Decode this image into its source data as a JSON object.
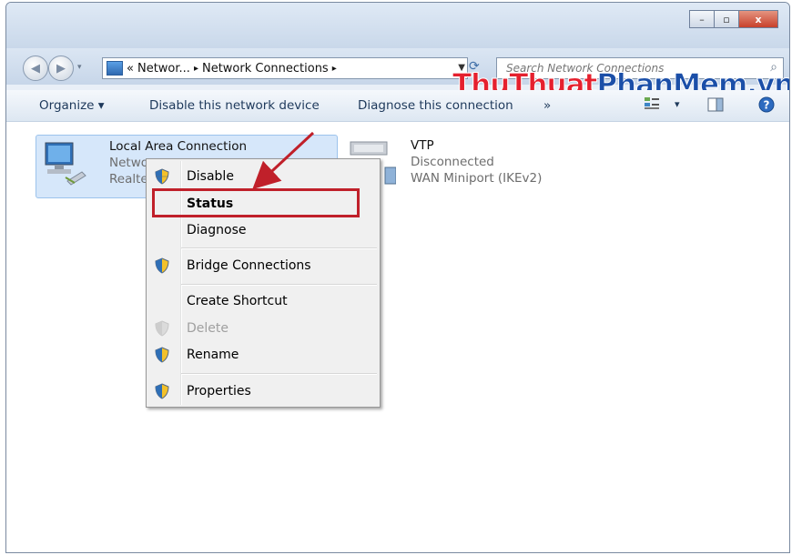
{
  "window": {
    "controls": {
      "minimize": "–",
      "maximize": "▫",
      "close": "x"
    }
  },
  "address": {
    "overflow": "«",
    "crumbs": [
      "Networ...",
      "Network Connections"
    ],
    "separator": "▸"
  },
  "search": {
    "placeholder": "Search Network Connections"
  },
  "watermark": {
    "part1": "ThuThuat",
    "part2": "PhanMem",
    "part3": ".vn"
  },
  "toolbar": {
    "organize": "Organize ▾",
    "disable": "Disable this network device",
    "diagnose": "Diagnose this connection",
    "more": "»",
    "views": "▾"
  },
  "connections": [
    {
      "name": "Local Area Connection",
      "line2": "Netwo",
      "line3": "Realtek"
    },
    {
      "name": "VTP",
      "line2": "Disconnected",
      "line3": "WAN Miniport (IKEv2)"
    }
  ],
  "context_menu": {
    "items": [
      {
        "label": "Disable",
        "shield": true
      },
      {
        "label": "Status",
        "bold": true
      },
      {
        "label": "Diagnose"
      },
      {
        "label": "Bridge Connections",
        "shield": true
      },
      {
        "label": "Create Shortcut"
      },
      {
        "label": "Delete",
        "disabled": true,
        "shield": true
      },
      {
        "label": "Rename",
        "shield": true
      },
      {
        "label": "Properties",
        "shield": true
      }
    ]
  },
  "colors": {
    "annotation": "#c0202a",
    "selection": "#d6e7fa",
    "toolbar_text": "#1e395b"
  }
}
